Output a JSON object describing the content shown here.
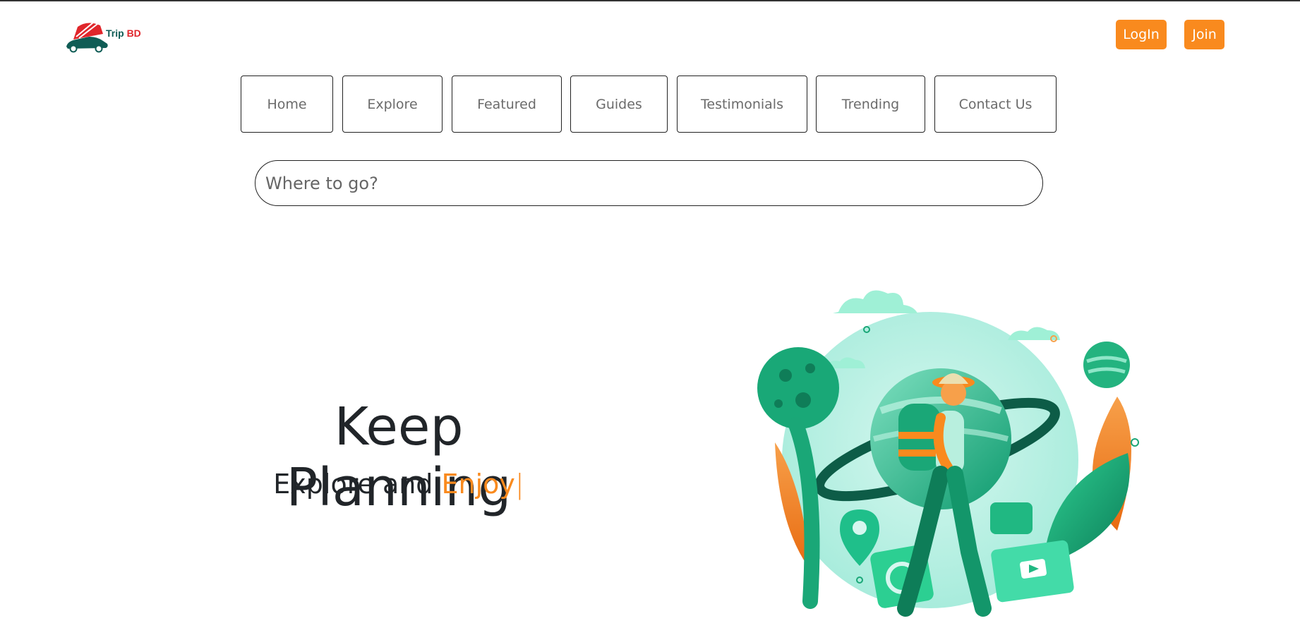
{
  "brand": {
    "logo_text_primary": "Trip",
    "logo_text_secondary": "BD",
    "colors": {
      "accent": "#f98a1e",
      "logo_red": "#e0262b",
      "logo_teal": "#0f5c55"
    }
  },
  "header": {
    "login_label": "LogIn",
    "join_label": "Join"
  },
  "nav": {
    "items": [
      {
        "label": "Home"
      },
      {
        "label": "Explore"
      },
      {
        "label": "Featured"
      },
      {
        "label": "Guides"
      },
      {
        "label": "Testimonials"
      },
      {
        "label": "Trending"
      },
      {
        "label": "Contact Us"
      }
    ]
  },
  "search": {
    "placeholder": "Where to go?",
    "value": ""
  },
  "hero": {
    "title": "Keep Planning",
    "subtitle_prefix": "Explore and ",
    "subtitle_highlight": "Enjoy",
    "cursor": "|",
    "illustration_icon": "traveler-illustration"
  }
}
